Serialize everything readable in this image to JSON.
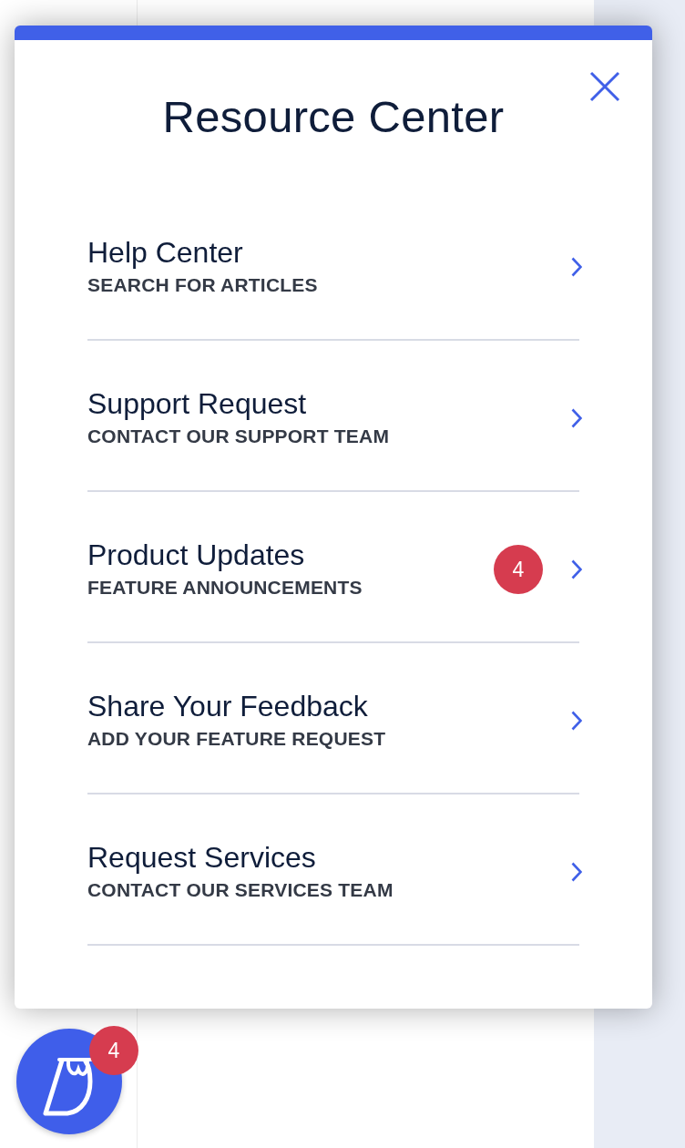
{
  "panel": {
    "title": "Resource Center"
  },
  "items": [
    {
      "title": "Help Center",
      "subtitle": "SEARCH FOR ARTICLES"
    },
    {
      "title": "Support Request",
      "subtitle": "CONTACT OUR SUPPORT TEAM"
    },
    {
      "title": "Product Updates",
      "subtitle": "FEATURE ANNOUNCEMENTS",
      "badge": "4"
    },
    {
      "title": "Share Your Feedback",
      "subtitle": "ADD YOUR FEATURE REQUEST"
    },
    {
      "title": "Request Services",
      "subtitle": "CONTACT OUR SERVICES TEAM"
    }
  ],
  "launcher": {
    "badge": "4"
  }
}
